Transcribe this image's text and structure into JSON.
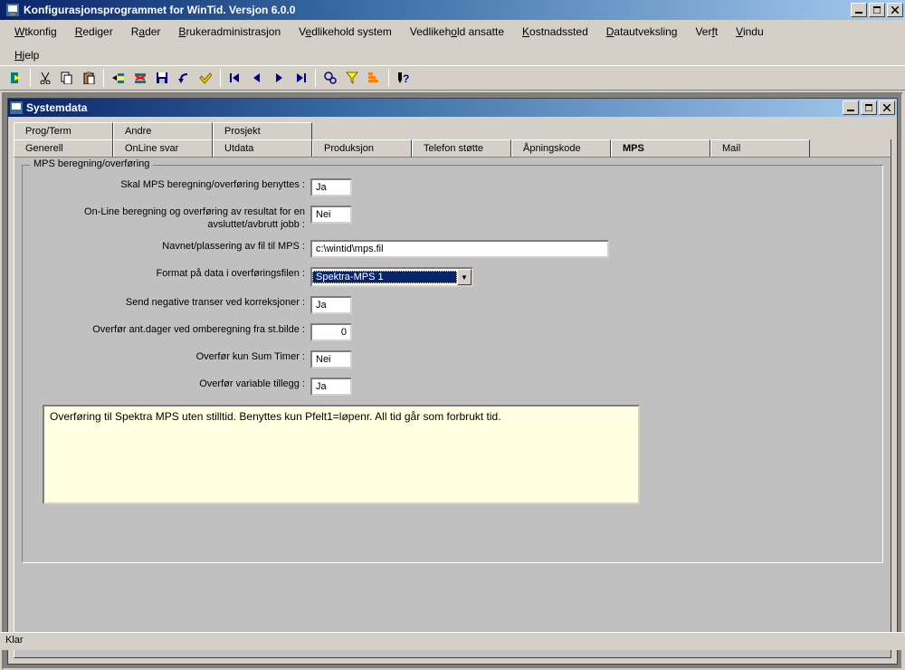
{
  "window": {
    "title": "Konfigurasjonsprogrammet for WinTid. Versjon 6.0.0"
  },
  "menu": {
    "items": [
      "Wtkonfig",
      "Rediger",
      "Rader",
      "Brukeradministrasjon",
      "Vedlikehold system",
      "Vedlikehold ansatte",
      "Kostnadssted",
      "Datautveksling",
      "Verft",
      "Vindu",
      "Hjelp"
    ],
    "underline_first": [
      0,
      0,
      0,
      0,
      0,
      0,
      0,
      0,
      0,
      0,
      0
    ]
  },
  "child_window": {
    "title": "Systemdata"
  },
  "tabs_row1": [
    "Prog/Term",
    "Andre",
    "Prosjekt"
  ],
  "tabs_row2": [
    "Generell",
    "OnLine svar",
    "Utdata",
    "Produksjon",
    "Telefon støtte",
    "Åpningskode",
    "MPS",
    "Mail"
  ],
  "active_tab": "MPS",
  "fieldset": {
    "legend": "MPS beregning/overføring",
    "rows": {
      "use_mps": {
        "label": "Skal MPS beregning/overføring benyttes :",
        "value": "Ja"
      },
      "online": {
        "label": "On-Line beregning og overføring av resultat for en avsluttet/avbrutt jobb :",
        "value": "Nei"
      },
      "filepath": {
        "label": "Navnet/plassering av fil til MPS :",
        "value": "c:\\wintid\\mps.fil"
      },
      "format": {
        "label": "Format på data i overføringsfilen :",
        "value": "Spektra-MPS 1"
      },
      "negtrans": {
        "label": "Send negative transer ved korreksjoner :",
        "value": "Ja"
      },
      "days": {
        "label": "Overfør ant.dager ved omberegning fra st.bilde :",
        "value": "0"
      },
      "sumtimer": {
        "label": "Overfør kun Sum Timer :",
        "value": "Nei"
      },
      "vartillegg": {
        "label": "Overfør variable tillegg :",
        "value": "Ja"
      }
    },
    "description": "Overføring til Spektra MPS uten stilltid. Benyttes kun Pfelt1=løpenr. All tid går som forbrukt tid."
  },
  "status": "Klar"
}
